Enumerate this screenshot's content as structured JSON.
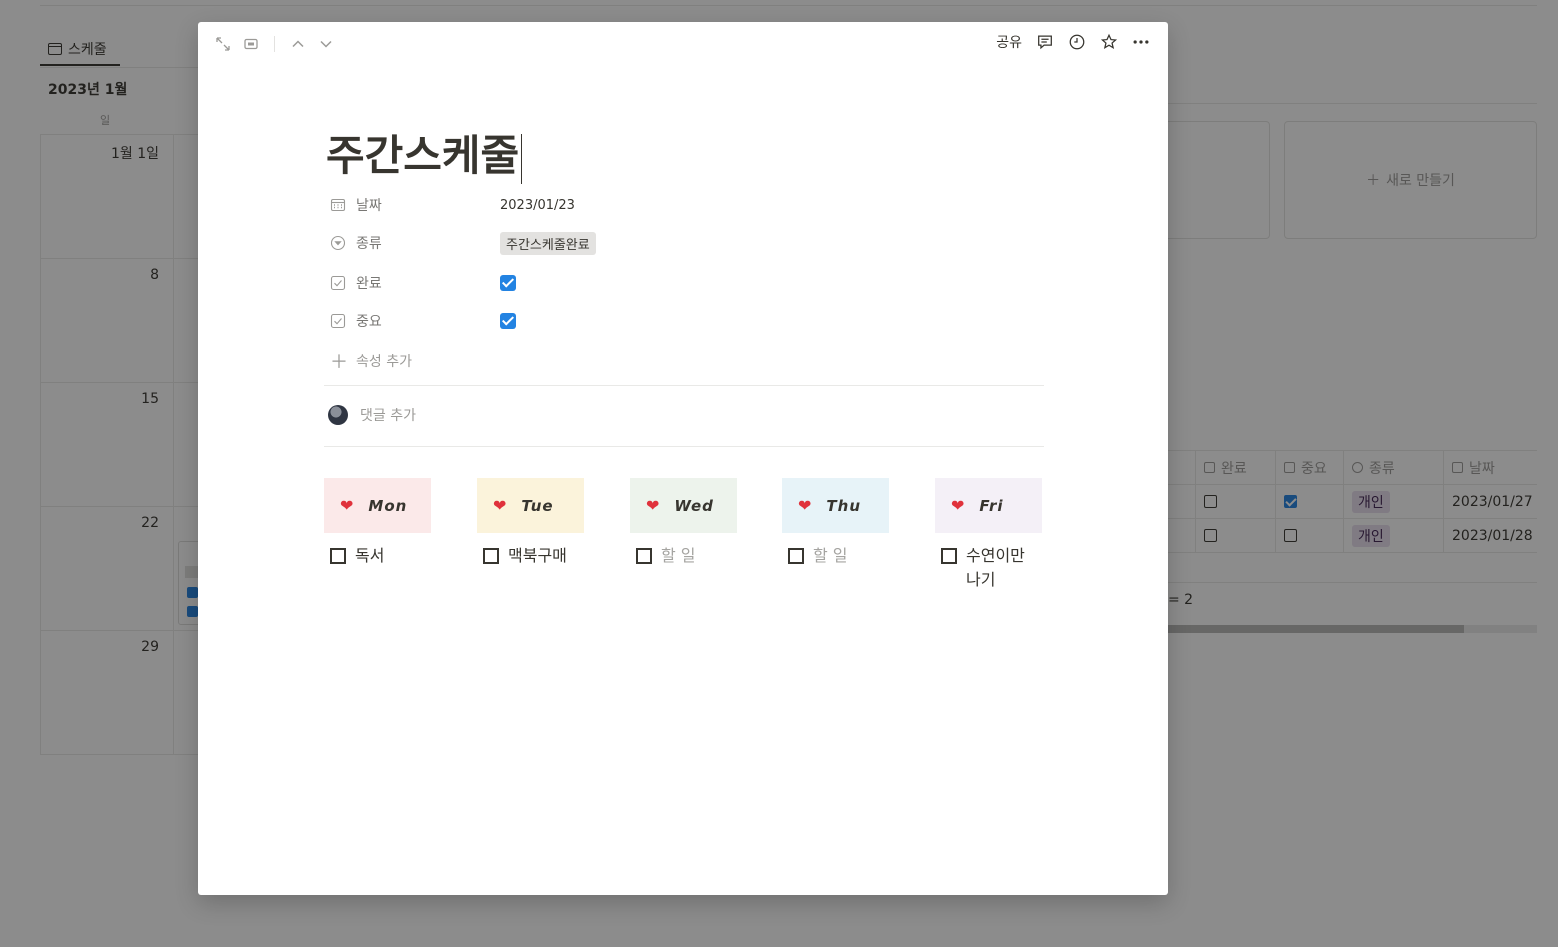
{
  "background": {
    "view_tab_label": "스케줄",
    "month_label": "2023년 1월",
    "weekday_label": "일",
    "week_numbers": [
      "1월 1일",
      "8",
      "15",
      "22",
      "29"
    ],
    "new_card_label": "새로 만들기",
    "table": {
      "headers": [
        "완료",
        "중요",
        "종류",
        "날짜"
      ],
      "rows": [
        {
          "done": false,
          "important": true,
          "type": "개인",
          "date": "2023/01/27"
        },
        {
          "done": false,
          "important": false,
          "type": "개인",
          "date": "2023/01/28"
        }
      ],
      "count_text": "= 2"
    },
    "colors": {
      "tag_personal_bg": "#e8deee",
      "checkbox_blue": "#2383e2"
    }
  },
  "modal": {
    "toolbar": {
      "share_label": "공유",
      "icons": [
        "expand-icon",
        "peek-mode-icon",
        "chevron-up-icon",
        "chevron-down-icon",
        "comment-icon",
        "history-icon",
        "star-icon",
        "more-icon"
      ]
    },
    "title": "주간스케줄",
    "properties": [
      {
        "icon": "calendar-icon",
        "name": "날짜",
        "value": "2023/01/23"
      },
      {
        "icon": "select-icon",
        "name": "종류",
        "value": "주간스케줄완료"
      },
      {
        "icon": "checkbox-icon",
        "name": "완료",
        "checked": true
      },
      {
        "icon": "checkbox-icon",
        "name": "중요",
        "checked": true
      }
    ],
    "add_property_label": "속성 추가",
    "comment_placeholder": "댓글 추가",
    "days": [
      {
        "label": "Mon",
        "bg": "#fbe9e9",
        "todo": "독서",
        "placeholder": false
      },
      {
        "label": "Tue",
        "bg": "#fbf3db",
        "todo": "맥북구매",
        "placeholder": false
      },
      {
        "label": "Wed",
        "bg": "#edf3ec",
        "todo": "할 일",
        "placeholder": true
      },
      {
        "label": "Thu",
        "bg": "#e7f3f8",
        "todo": "할 일",
        "placeholder": true
      },
      {
        "label": "Fri",
        "bg": "#f4f0f7",
        "todo": "수연이만 나기",
        "placeholder": false
      }
    ]
  }
}
